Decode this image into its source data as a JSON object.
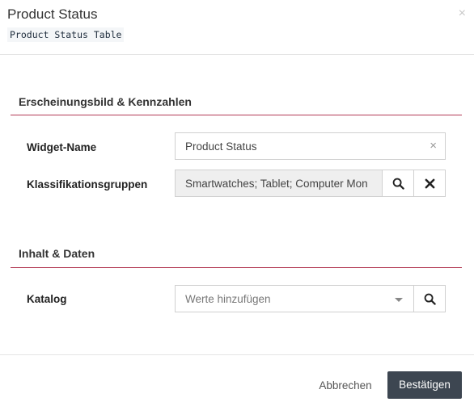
{
  "dialog": {
    "title": "Product Status",
    "subtitle": "Product Status Table",
    "close_symbol": "×"
  },
  "sections": [
    {
      "title": "Erscheinungsbild & Kennzahlen"
    },
    {
      "title": "Inhalt & Daten"
    }
  ],
  "fields": {
    "widget_name": {
      "label": "Widget-Name",
      "value": "Product Status",
      "clear_symbol": "×"
    },
    "classification_groups": {
      "label": "Klassifikationsgruppen",
      "value": "Smartwatches; Tablet; Computer Mon"
    },
    "catalog": {
      "label": "Katalog",
      "placeholder": "Werte hinzufügen"
    }
  },
  "footer": {
    "cancel_label": "Abbrechen",
    "confirm_label": "Bestätigen"
  },
  "icons": {
    "search": "search-icon",
    "remove": "remove-icon",
    "dropdown": "chevron-down-icon"
  },
  "colors": {
    "section_rule": "#b33a55",
    "confirm_button": "#3d4651"
  }
}
